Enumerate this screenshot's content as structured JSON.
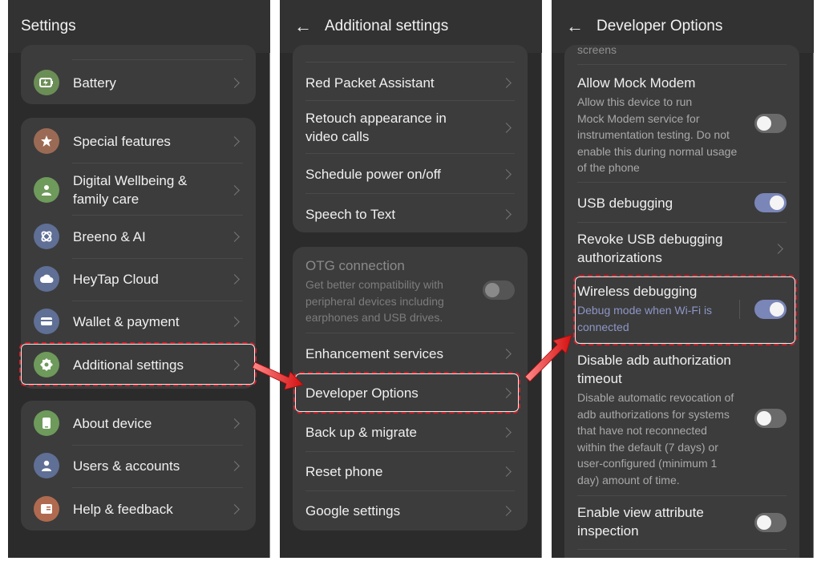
{
  "panel1": {
    "title": "Settings",
    "battery": "Battery",
    "group2": [
      "Special features",
      "Digital Wellbeing &",
      "family care",
      "Breeno & AI",
      "HeyTap Cloud",
      "Wallet & payment",
      "Additional settings"
    ],
    "group3": [
      "About device",
      "Users & accounts",
      "Help & feedback"
    ]
  },
  "panel2": {
    "title": "Additional settings",
    "group1": [
      "Red Packet Assistant",
      "Retouch appearance in",
      "video calls",
      "Schedule power on/off",
      "Speech to Text"
    ],
    "otg": {
      "label": "OTG connection",
      "desc": [
        "Get better compatibility with",
        "peripheral devices including",
        "earphones and USB drives."
      ]
    },
    "group2": [
      "Enhancement services",
      "Developer Options",
      "Back up & migrate",
      "Reset phone",
      "Google settings"
    ]
  },
  "panel3": {
    "title": "Developer Options",
    "cut_text": "screens",
    "mock": {
      "label": "Allow Mock Modem",
      "desc": [
        "Allow this device to run",
        "Mock Modem service for",
        "instrumentation testing. Do not",
        "enable this during normal usage",
        "of the phone"
      ]
    },
    "usb": "USB debugging",
    "revoke": [
      "Revoke USB debugging",
      "authorizations"
    ],
    "wireless": {
      "label": "Wireless debugging",
      "desc": [
        "Debug mode when Wi-Fi is",
        "connected"
      ]
    },
    "adb": {
      "label": [
        "Disable adb authorization",
        "timeout"
      ],
      "desc": [
        "Disable automatic revocation of",
        "adb authorizations for systems",
        "that have not reconnected",
        "within the default (7 days) or",
        "user-configured (minimum 1",
        "day) amount of time."
      ]
    },
    "view": [
      "Enable view attribute",
      "inspection"
    ]
  },
  "colors": {
    "accent": "#7a86b8",
    "highlight": "#d01f2a"
  }
}
